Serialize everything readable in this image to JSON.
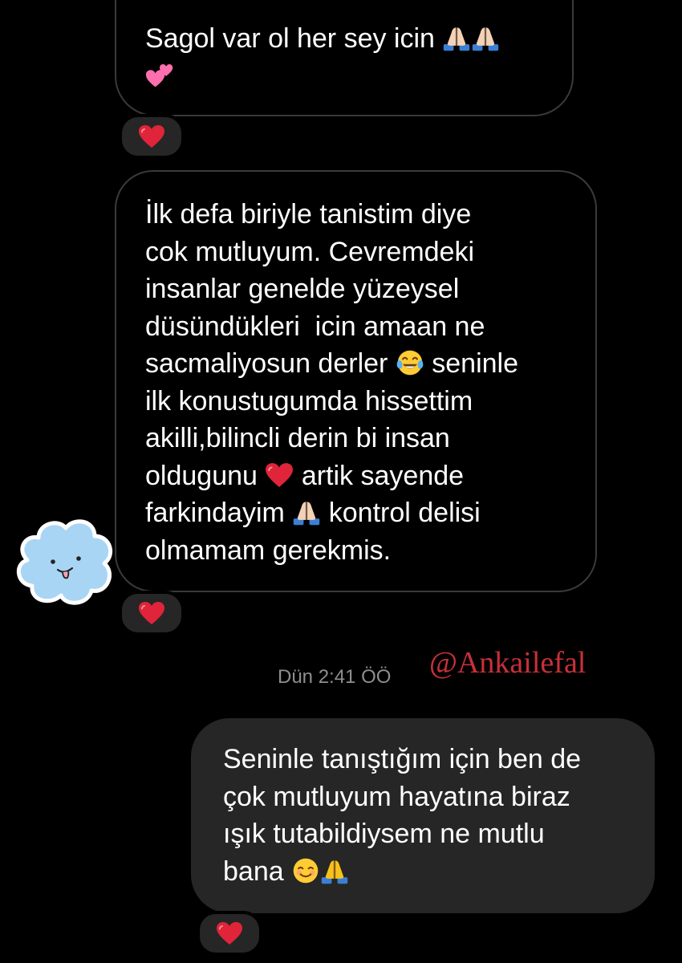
{
  "conversation": {
    "messages": [
      {
        "direction": "incoming",
        "lines": [
          "Sagol var ol her sey icin",
          ""
        ],
        "emojis": [
          "folded-hands",
          "folded-hands",
          "two-hearts"
        ],
        "reaction": "red-heart"
      },
      {
        "direction": "incoming",
        "lines": [
          "İlk defa biriyle tanistim diye",
          "cok mutluyum. Cevremdeki",
          "insanlar genelde yüzeysel",
          "düsündükleri  icin amaan ne",
          "sacmaliyosun derler",
          "seninle",
          "ilk konustugumda hissettim",
          "akilli,bilincli derin bi insan",
          "oldugunu",
          "artik sayende",
          "farkindayim",
          "kontrol delisi",
          "olmamam gerekmis."
        ],
        "emojis": [
          "tears-of-joy",
          "red-heart",
          "folded-hands"
        ],
        "reaction": "red-heart"
      },
      {
        "direction": "outgoing",
        "lines": [
          "Seninle tanıştığım için ben de",
          "çok mutluyum hayatına biraz",
          "ışık tutabildiysem ne mutlu",
          "bana"
        ],
        "emojis": [
          "smiling-face",
          "folded-hands"
        ],
        "reaction": "red-heart"
      }
    ],
    "timestamp": "Dün 2:41 ÖÖ"
  },
  "watermark": "@Ankailefal",
  "sticker": "cloud-face-sticker",
  "colors": {
    "background": "#000000",
    "incoming_border": "#3a3a3a",
    "outgoing_bubble": "#262626",
    "heart": "#e0243a",
    "watermark": "#c8303a",
    "timestamp": "#8e8e8e",
    "sticker": "#a9d5f5"
  }
}
